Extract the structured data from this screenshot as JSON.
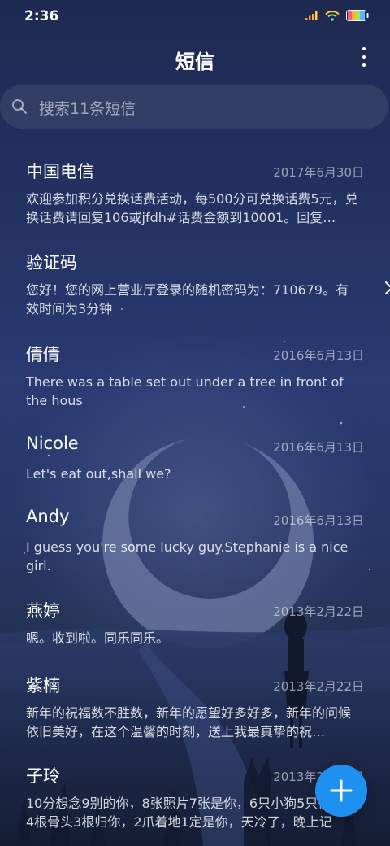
{
  "status_bar": {
    "time": "2:36"
  },
  "header": {
    "title": "短信"
  },
  "search": {
    "placeholder": "搜索11条短信"
  },
  "messages": [
    {
      "name": "中国电信",
      "date": "2017年6月30日",
      "text": "欢迎参加积分兑换话费活动，每500分可兑换话费5元，兑换话费请回复106或jfdh#话费金额到10001。回复…"
    },
    {
      "name": "验证码",
      "date": "",
      "text": "您好！您的网上营业厅登录的随机密码为：710679。有效时间为3分钟"
    },
    {
      "name": "倩倩",
      "date": "2016年6月13日",
      "text": "There was a table set out under a tree in front of the hous"
    },
    {
      "name": "Nicole",
      "date": "2016年6月13日",
      "text": "Let's eat out,shall we?"
    },
    {
      "name": "Andy",
      "date": "2016年6月13日",
      "text": "I guess you're some lucky guy.Stephanie is a nice girl."
    },
    {
      "name": "燕婷",
      "date": "2013年2月22日",
      "text": "嗯。收到啦。同乐同乐。"
    },
    {
      "name": "紫楠",
      "date": "2013年2月22日",
      "text": "新年的祝福数不胜数，新年的愿望好多好多，新年的问候依旧美好，在这个温馨的时刻，送上我最真挚的祝…"
    },
    {
      "name": "子玲",
      "date": "2013年2月22日",
      "text": "10分想念9别的你，8张照片7张是你，6只小狗5只像你，4根骨头3根归你，2爪着地1定是你，天冷了，晚上记"
    }
  ],
  "icons": {
    "more": "more-vertical-icon",
    "search": "search-icon",
    "chevron": "chevron-right-icon",
    "fab": "plus-icon"
  },
  "colors": {
    "accent": "#1e90f0"
  }
}
